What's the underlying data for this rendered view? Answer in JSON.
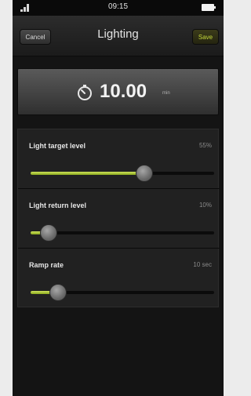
{
  "status_bar": {
    "time": "09:15"
  },
  "nav": {
    "cancel_label": "Cancel",
    "title": "Lighting",
    "save_label": "Save"
  },
  "timer": {
    "value": "10.00",
    "unit": "min",
    "icon": "stopwatch-icon"
  },
  "settings": [
    {
      "label": "Light target level",
      "value": "55%",
      "level": 0.62
    },
    {
      "label": "Light return level",
      "value": "10%",
      "level": 0.1
    },
    {
      "label": "Ramp rate",
      "value": "10 sec",
      "level": 0.15
    }
  ],
  "colors": {
    "accent": "#a4c232",
    "save_text": "#c5d93a"
  }
}
